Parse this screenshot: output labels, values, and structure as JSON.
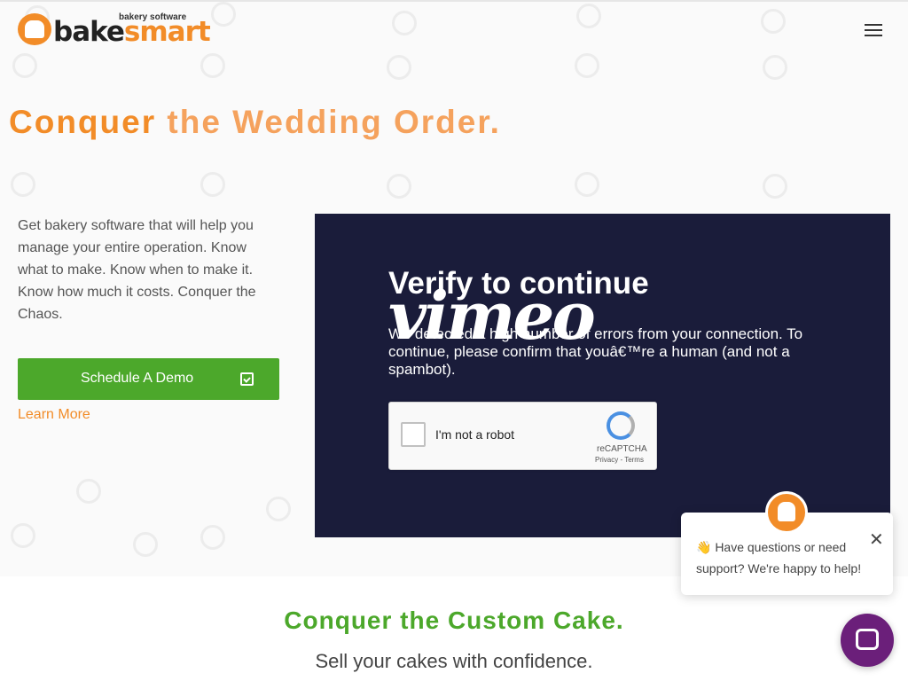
{
  "header": {
    "logo_small": "bakery software",
    "logo_word_1": "bake",
    "logo_word_2": "smart",
    "menu_icon": "hamburger-icon"
  },
  "hero": {
    "title_part1": "Conquer ",
    "title_part2": "the Wedding Order.",
    "intro": "Get bakery software that will help you manage your entire operation. Know what to make. Know when to make it. Know how much it costs. Conquer the Chaos.",
    "demo_button": "Schedule A Demo",
    "demo_icon": "calendar-check-icon",
    "learn_more": "Learn More"
  },
  "video": {
    "verify_title": "Verify to continue",
    "vimeo_logo": "vimeo",
    "message": "We detected a high number of errors from your connection. To continue, please confirm that youâ€™re a human (and not a spambot).",
    "recaptcha_label": "I'm not a robot",
    "recaptcha_brand": "reCAPTCHA",
    "recaptcha_terms": "Privacy - Terms"
  },
  "section2": {
    "title": "Conquer the Custom Cake.",
    "subtitle": "Sell your cakes with confidence."
  },
  "chat": {
    "message": "👋 Have questions or need support? We're happy to help!",
    "close": "✕",
    "launcher_icon": "chat-icon"
  },
  "colors": {
    "brand_orange": "#f28c28",
    "brand_green": "#4ca82b",
    "video_bg": "#1a1c3a",
    "chat_purple": "#6b1f7a"
  }
}
